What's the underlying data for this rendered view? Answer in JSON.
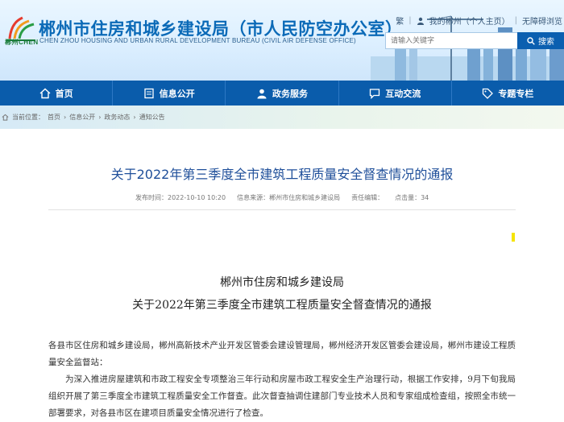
{
  "header": {
    "logo_text": "郴州CHEN",
    "title": "郴州市住房和城乡建设局（市人民防空办公室）",
    "subtitle": "CHEN ZHOU HOUSING AND URBAN RURAL DEVELOPMENT BUREAU (CIVIL AIR DEFENSE OFFICE)",
    "top_links": [
      "繁",
      "我的郴州（个人主页）",
      "无障碍浏览"
    ],
    "search": {
      "placeholder": "请输入关键字",
      "button_label": "搜索"
    }
  },
  "nav": {
    "items": [
      {
        "label": "首页",
        "icon": "home-icon"
      },
      {
        "label": "信息公开",
        "icon": "info-icon"
      },
      {
        "label": "政务服务",
        "icon": "user-icon"
      },
      {
        "label": "互动交流",
        "icon": "chat-icon"
      },
      {
        "label": "专题专栏",
        "icon": "tag-icon"
      }
    ]
  },
  "breadcrumb": {
    "prefix": "当前位置：",
    "items": [
      "首页",
      "信息公开",
      "政务动态",
      "通知公告"
    ],
    "separator": "›"
  },
  "article": {
    "title": "关于2022年第三季度全市建筑工程质量安全督查情况的通报",
    "publish_time": "发布时间：2022-10-10 10:20",
    "source": "信息来源：郴州市住房和城乡建设局",
    "author": "责任编辑：",
    "clicks": "点击量：34",
    "doc_org": "郴州市住房和城乡建设局",
    "doc_title": "关于2022年第三季度全市建筑工程质量安全督查情况的通报",
    "paragraphs": [
      "各县市区住房和城乡建设局，郴州高新技术产业开发区管委会建设管理局，郴州经济开发区管委会建设局，郴州市建设工程质量安全监督站：",
      "为深入推进房屋建筑和市政工程安全专项整治三年行动和房屋市政工程安全生产治理行动，根据工作安排，9月下旬我局组织开展了第三季度全市建筑工程质量安全工作督查。此次督查抽调住建部门专业技术人员和专家组成检查组，按照全市统一部署要求，对各县市区在建项目质量安全情况进行了检查。"
    ]
  },
  "colors": {
    "nav_bg": "#0a5cab",
    "title_blue": "#0b6ab7",
    "article_title": "#1f4f9a"
  }
}
